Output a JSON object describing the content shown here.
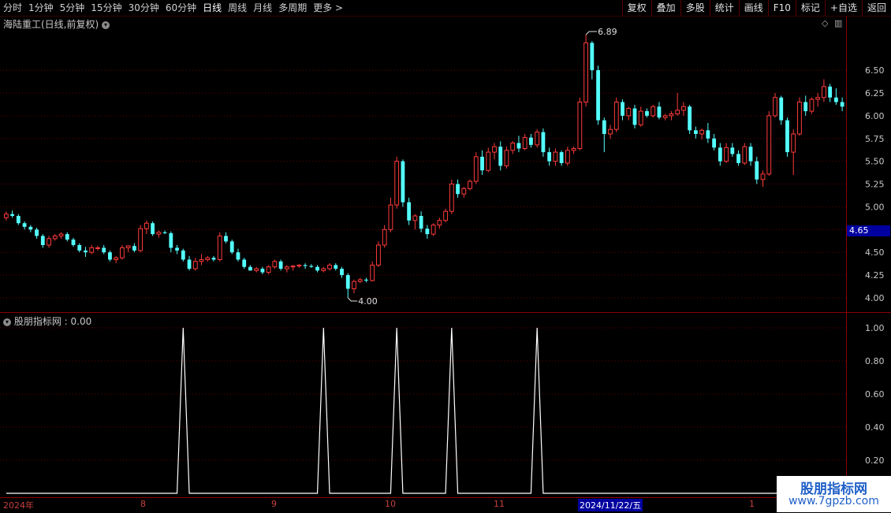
{
  "toolbar": {
    "periods": [
      "分时",
      "1分钟",
      "5分钟",
      "15分钟",
      "30分钟",
      "60分钟",
      "日线",
      "周线",
      "月线",
      "多周期",
      "更多 >"
    ],
    "active_period": "日线",
    "buttons": [
      "复权",
      "叠加",
      "多股",
      "统计",
      "画线",
      "F10",
      "标记",
      "+自选",
      "返回"
    ]
  },
  "main_pane": {
    "title": "海陆重工(日线,前复权)",
    "high_label": "6.89",
    "low_label": "4.00",
    "current_price": "4.65",
    "y_ticks": [
      "6.50",
      "6.25",
      "6.00",
      "5.75",
      "5.50",
      "5.25",
      "5.00",
      "4.75",
      "4.50",
      "4.25",
      "4.00"
    ]
  },
  "indicator_pane": {
    "title": "股朋指标网 : 0.00",
    "y_ticks": [
      "1.00",
      "0.80",
      "0.60",
      "0.40",
      "0.20"
    ]
  },
  "x_axis": {
    "labels": [
      "2024年",
      "8",
      "9",
      "10",
      "11",
      "2024/11/22/五",
      "1"
    ]
  },
  "watermark": {
    "line1": "股朋指标网",
    "line2": "www.7gpzb.com"
  },
  "colors": {
    "up": "#ff3b3b",
    "down": "#54ffff",
    "grid": "#6a0000",
    "axis_red": "#8c0000"
  },
  "chart_data": [
    {
      "type": "candlestick",
      "title": "海陆重工(日线,前复权)",
      "ylim": [
        4.0,
        6.89
      ],
      "y_ticks": [
        4.0,
        4.25,
        4.5,
        4.75,
        5.0,
        5.25,
        5.5,
        5.75,
        6.0,
        6.25,
        6.5
      ],
      "candles": [
        [
          4.88,
          4.95,
          4.85,
          4.92
        ],
        [
          4.92,
          4.96,
          4.88,
          4.9
        ],
        [
          4.9,
          4.92,
          4.8,
          4.82
        ],
        [
          4.82,
          4.84,
          4.75,
          4.78
        ],
        [
          4.78,
          4.8,
          4.72,
          4.75
        ],
        [
          4.75,
          4.77,
          4.65,
          4.68
        ],
        [
          4.68,
          4.7,
          4.55,
          4.58
        ],
        [
          4.58,
          4.68,
          4.55,
          4.65
        ],
        [
          4.65,
          4.7,
          4.63,
          4.68
        ],
        [
          4.68,
          4.72,
          4.65,
          4.7
        ],
        [
          4.7,
          4.72,
          4.62,
          4.64
        ],
        [
          4.64,
          4.66,
          4.56,
          4.58
        ],
        [
          4.58,
          4.6,
          4.5,
          4.52
        ],
        [
          4.52,
          4.56,
          4.45,
          4.5
        ],
        [
          4.5,
          4.58,
          4.48,
          4.55
        ],
        [
          4.55,
          4.57,
          4.52,
          4.55
        ],
        [
          4.55,
          4.58,
          4.48,
          4.5
        ],
        [
          4.5,
          4.52,
          4.4,
          4.42
        ],
        [
          4.42,
          4.46,
          4.38,
          4.44
        ],
        [
          4.44,
          4.58,
          4.42,
          4.55
        ],
        [
          4.55,
          4.58,
          4.5,
          4.57
        ],
        [
          4.57,
          4.6,
          4.5,
          4.52
        ],
        [
          4.52,
          4.8,
          4.5,
          4.76
        ],
        [
          4.76,
          4.85,
          4.7,
          4.82
        ],
        [
          4.82,
          4.84,
          4.68,
          4.7
        ],
        [
          4.7,
          4.74,
          4.66,
          4.72
        ],
        [
          4.72,
          4.74,
          4.7,
          4.71
        ],
        [
          4.71,
          4.73,
          4.5,
          4.55
        ],
        [
          4.55,
          4.58,
          4.48,
          4.52
        ],
        [
          4.52,
          4.54,
          4.4,
          4.42
        ],
        [
          4.42,
          4.46,
          4.3,
          4.32
        ],
        [
          4.32,
          4.44,
          4.3,
          4.4
        ],
        [
          4.4,
          4.48,
          4.36,
          4.42
        ],
        [
          4.42,
          4.46,
          4.4,
          4.44
        ],
        [
          4.44,
          4.46,
          4.4,
          4.42
        ],
        [
          4.42,
          4.72,
          4.4,
          4.68
        ],
        [
          4.68,
          4.72,
          4.6,
          4.62
        ],
        [
          4.62,
          4.64,
          4.48,
          4.5
        ],
        [
          4.5,
          4.54,
          4.4,
          4.42
        ],
        [
          4.42,
          4.44,
          4.32,
          4.34
        ],
        [
          4.34,
          4.36,
          4.3,
          4.3
        ],
        [
          4.3,
          4.34,
          4.28,
          4.32
        ],
        [
          4.32,
          4.34,
          4.26,
          4.28
        ],
        [
          4.28,
          4.36,
          4.26,
          4.34
        ],
        [
          4.34,
          4.42,
          4.32,
          4.4
        ],
        [
          4.4,
          4.42,
          4.3,
          4.32
        ],
        [
          4.32,
          4.36,
          4.28,
          4.34
        ],
        [
          4.34,
          4.36,
          4.3,
          4.35
        ],
        [
          4.35,
          4.37,
          4.33,
          4.36
        ],
        [
          4.36,
          4.38,
          4.32,
          4.35
        ],
        [
          4.35,
          4.37,
          4.33,
          4.34
        ],
        [
          4.34,
          4.36,
          4.28,
          4.3
        ],
        [
          4.3,
          4.34,
          4.28,
          4.32
        ],
        [
          4.32,
          4.38,
          4.3,
          4.36
        ],
        [
          4.36,
          4.38,
          4.3,
          4.32
        ],
        [
          4.32,
          4.34,
          4.22,
          4.25
        ],
        [
          4.25,
          4.27,
          4.0,
          4.1
        ],
        [
          4.1,
          4.2,
          4.05,
          4.18
        ],
        [
          4.18,
          4.22,
          4.16,
          4.2
        ],
        [
          4.2,
          4.22,
          4.17,
          4.19
        ],
        [
          4.19,
          4.4,
          4.18,
          4.36
        ],
        [
          4.36,
          4.62,
          4.34,
          4.58
        ],
        [
          4.58,
          4.8,
          4.55,
          4.75
        ],
        [
          4.75,
          5.1,
          4.72,
          5.02
        ],
        [
          5.02,
          5.55,
          4.98,
          5.5
        ],
        [
          5.5,
          5.52,
          5.0,
          5.05
        ],
        [
          5.05,
          5.1,
          4.8,
          4.85
        ],
        [
          4.85,
          4.92,
          4.75,
          4.9
        ],
        [
          4.9,
          4.95,
          4.72,
          4.76
        ],
        [
          4.76,
          4.8,
          4.65,
          4.7
        ],
        [
          4.7,
          4.82,
          4.68,
          4.8
        ],
        [
          4.8,
          4.88,
          4.76,
          4.85
        ],
        [
          4.85,
          4.98,
          4.83,
          4.95
        ],
        [
          4.95,
          5.3,
          4.92,
          5.25
        ],
        [
          5.25,
          5.3,
          5.1,
          5.14
        ],
        [
          5.14,
          5.22,
          5.1,
          5.2
        ],
        [
          5.2,
          5.3,
          5.18,
          5.28
        ],
        [
          5.28,
          5.6,
          5.25,
          5.55
        ],
        [
          5.55,
          5.62,
          5.35,
          5.4
        ],
        [
          5.4,
          5.65,
          5.38,
          5.6
        ],
        [
          5.6,
          5.7,
          5.52,
          5.66
        ],
        [
          5.66,
          5.72,
          5.4,
          5.45
        ],
        [
          5.45,
          5.66,
          5.42,
          5.62
        ],
        [
          5.62,
          5.72,
          5.58,
          5.7
        ],
        [
          5.7,
          5.78,
          5.6,
          5.64
        ],
        [
          5.64,
          5.8,
          5.62,
          5.76
        ],
        [
          5.76,
          5.8,
          5.65,
          5.68
        ],
        [
          5.68,
          5.85,
          5.65,
          5.82
        ],
        [
          5.82,
          5.86,
          5.55,
          5.6
        ],
        [
          5.6,
          5.65,
          5.45,
          5.5
        ],
        [
          5.5,
          5.64,
          5.45,
          5.6
        ],
        [
          5.6,
          5.62,
          5.45,
          5.48
        ],
        [
          5.48,
          5.66,
          5.45,
          5.62
        ],
        [
          5.62,
          5.66,
          5.58,
          5.64
        ],
        [
          5.64,
          6.2,
          5.62,
          6.15
        ],
        [
          6.15,
          6.89,
          6.1,
          6.8
        ],
        [
          6.8,
          6.82,
          6.4,
          6.5
        ],
        [
          6.5,
          6.55,
          5.9,
          5.95
        ],
        [
          5.95,
          5.98,
          5.6,
          5.8
        ],
        [
          5.8,
          5.9,
          5.75,
          5.85
        ],
        [
          5.85,
          6.2,
          5.82,
          6.15
        ],
        [
          6.15,
          6.18,
          5.95,
          6.0
        ],
        [
          6.0,
          6.1,
          5.95,
          6.08
        ],
        [
          6.08,
          6.12,
          5.86,
          5.9
        ],
        [
          5.9,
          6.1,
          5.88,
          6.05
        ],
        [
          6.05,
          6.08,
          5.98,
          6.0
        ],
        [
          6.0,
          6.12,
          5.98,
          6.1
        ],
        [
          6.1,
          6.15,
          5.96,
          5.98
        ],
        [
          5.98,
          6.02,
          5.95,
          6.0
        ],
        [
          6.0,
          6.05,
          5.95,
          6.02
        ],
        [
          6.02,
          6.25,
          6.0,
          6.06
        ],
        [
          6.06,
          6.15,
          6.0,
          6.1
        ],
        [
          6.1,
          6.12,
          5.8,
          5.84
        ],
        [
          5.84,
          5.88,
          5.75,
          5.8
        ],
        [
          5.8,
          5.86,
          5.74,
          5.84
        ],
        [
          5.84,
          5.92,
          5.7,
          5.75
        ],
        [
          5.75,
          5.8,
          5.62,
          5.65
        ],
        [
          5.65,
          5.7,
          5.45,
          5.5
        ],
        [
          5.5,
          5.7,
          5.48,
          5.65
        ],
        [
          5.65,
          5.7,
          5.55,
          5.58
        ],
        [
          5.58,
          5.62,
          5.45,
          5.48
        ],
        [
          5.48,
          5.7,
          5.46,
          5.66
        ],
        [
          5.66,
          5.7,
          5.45,
          5.5
        ],
        [
          5.5,
          5.55,
          5.25,
          5.3
        ],
        [
          5.3,
          5.4,
          5.22,
          5.36
        ],
        [
          5.36,
          6.05,
          5.34,
          6.0
        ],
        [
          6.0,
          6.25,
          5.98,
          6.2
        ],
        [
          6.2,
          6.22,
          5.9,
          5.95
        ],
        [
          5.95,
          5.98,
          5.55,
          5.6
        ],
        [
          5.6,
          5.85,
          5.35,
          5.8
        ],
        [
          5.8,
          6.2,
          5.78,
          6.15
        ],
        [
          6.15,
          6.22,
          6.0,
          6.05
        ],
        [
          6.05,
          6.2,
          6.02,
          6.18
        ],
        [
          6.18,
          6.25,
          6.1,
          6.2
        ],
        [
          6.2,
          6.4,
          6.15,
          6.32
        ],
        [
          6.32,
          6.35,
          6.15,
          6.2
        ],
        [
          6.2,
          6.3,
          6.12,
          6.15
        ],
        [
          6.15,
          6.2,
          6.05,
          6.1
        ]
      ]
    },
    {
      "type": "line",
      "title": "股朋指标网 : 0.00",
      "ylim": [
        0,
        1.0
      ],
      "y_ticks": [
        0.2,
        0.4,
        0.6,
        0.8,
        1.0
      ],
      "spikes_at_index": [
        29,
        52,
        64,
        73,
        87
      ],
      "spike_value": 1.0,
      "baseline": 0.0
    }
  ]
}
